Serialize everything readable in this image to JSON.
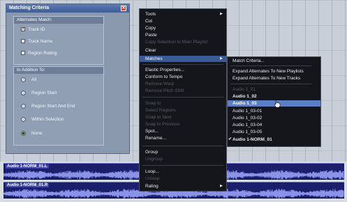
{
  "criteria_panel": {
    "title": "Matching Criteria",
    "alternates_group": {
      "title": "Alternates Match:",
      "options": [
        {
          "label": "Track ID",
          "checked": true
        },
        {
          "label": "Track Name",
          "checked": false
        },
        {
          "label": "Region Rating",
          "checked": false
        }
      ]
    },
    "addition_group": {
      "title": "In Addition To:",
      "options": [
        {
          "label": "All",
          "selected": false
        },
        {
          "label": "Region Start",
          "selected": false
        },
        {
          "label": "Region Start And End",
          "selected": false
        },
        {
          "label": "Within Selection",
          "selected": false
        },
        {
          "label": "None",
          "selected": true
        }
      ]
    }
  },
  "context_menu": {
    "items": [
      {
        "label": "Tools",
        "submenu": true,
        "enabled": true
      },
      {
        "label": "Cut",
        "enabled": true
      },
      {
        "label": "Copy",
        "enabled": true
      },
      {
        "label": "Paste",
        "enabled": true
      },
      {
        "label": "Copy Selection to Main Playlist",
        "enabled": false
      },
      {
        "label": "Clear",
        "enabled": true
      },
      {
        "label": "Matches",
        "submenu": true,
        "enabled": true,
        "highlighted": true
      },
      {
        "label": "Elastic Properties...",
        "enabled": true
      },
      {
        "label": "Conform to Tempo",
        "enabled": true
      },
      {
        "label": "Remove Warp",
        "enabled": false
      },
      {
        "label": "Remove Pitch Shift",
        "enabled": false
      },
      {
        "label": "Snap to",
        "enabled": false
      },
      {
        "label": "Select Regions",
        "enabled": false
      },
      {
        "label": "Snap to Next",
        "enabled": false
      },
      {
        "label": "Snap to Previous",
        "enabled": false
      },
      {
        "label": "Spot...",
        "enabled": true
      },
      {
        "label": "Rename...",
        "enabled": true
      },
      {
        "label": "Group",
        "enabled": true
      },
      {
        "label": "Ungroup",
        "enabled": false
      },
      {
        "label": "Loop...",
        "enabled": true
      },
      {
        "label": "Unloop",
        "enabled": false
      },
      {
        "label": "Rating",
        "submenu": true,
        "enabled": true
      }
    ]
  },
  "matches_submenu": {
    "items": [
      {
        "label": "Match Criteria...",
        "enabled": true
      },
      {
        "label": "Expand Alternates To New Playlists",
        "enabled": true
      },
      {
        "label": "Expand Alternates To New Tracks",
        "enabled": true
      },
      {
        "label": "Audio 1_01",
        "enabled": false
      },
      {
        "label": "Audio 1_02",
        "enabled": true,
        "bold": true
      },
      {
        "label": "Audio 1_03",
        "enabled": true,
        "bold": true,
        "selected": true
      },
      {
        "label": "Audio 1_03-01",
        "enabled": true
      },
      {
        "label": "Audio 1_03-02",
        "enabled": true
      },
      {
        "label": "Audio 1_03-04",
        "enabled": true
      },
      {
        "label": "Audio 1_03-05",
        "enabled": true
      },
      {
        "label": "Audio 1-NORM_01",
        "enabled": true,
        "bold": true,
        "checked": true
      }
    ]
  },
  "tracks": [
    {
      "clip_name": "Audio 1-NORM_01.L"
    },
    {
      "clip_name": "Audio 1-NORM_01.R"
    }
  ],
  "colors": {
    "menu_bg": "#14161b",
    "highlight": "#3a5a95",
    "selection": "#5a7fc6",
    "waveform": "#8b93e8",
    "lane_bg": "#1b1f6b"
  }
}
